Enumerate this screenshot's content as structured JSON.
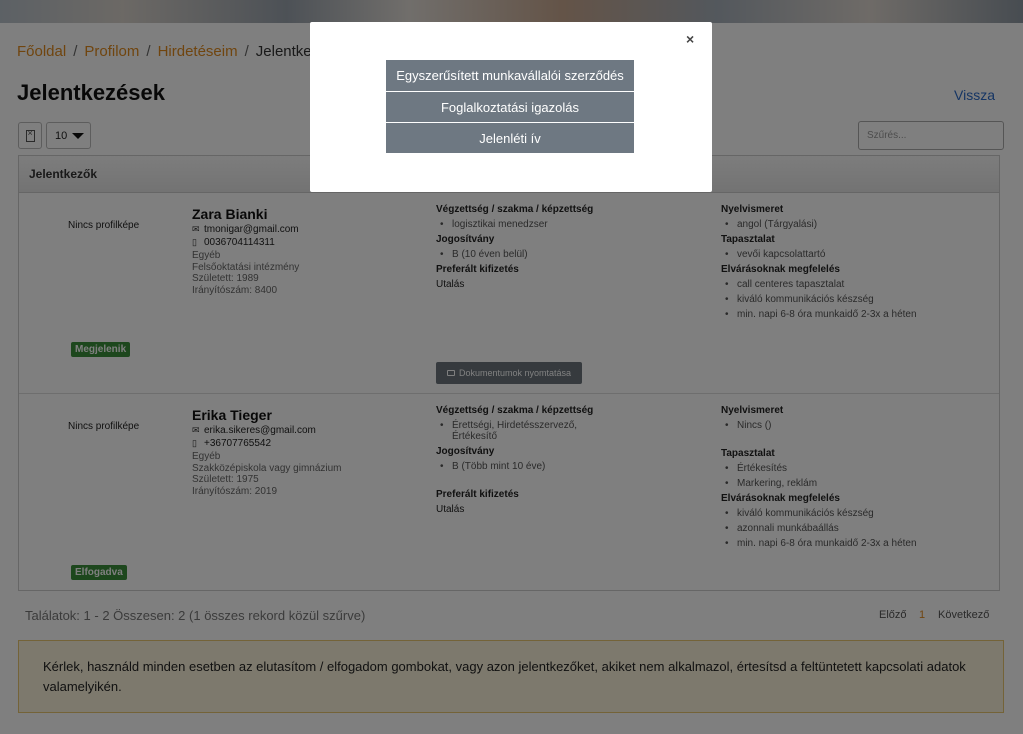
{
  "breadcrumb": {
    "home": "Főoldal",
    "profile": "Profilom",
    "ads": "Hirdetéseim",
    "current": "Jelentkez"
  },
  "page_title": "Jelentkezések",
  "back_label": "Vissza",
  "toolbar": {
    "excel_icon": "excel-export-icon",
    "per_page": "10",
    "filter_placeholder": "Szűrés..."
  },
  "panel_title": "Jelentkezők",
  "applicants": [
    {
      "photo_text": "Nincs profilképe",
      "name": "Zara Bianki",
      "email": "tmonigar@gmail.com",
      "phone": "0036704114311",
      "meta": [
        "Egyéb",
        "Felsőoktatási intézmény",
        "Született: 1989",
        "Irányítószám: 8400"
      ],
      "status": "Megjelenik",
      "col2": {
        "edu_title": "Végzettség / szakma / képzettség",
        "edu": [
          "logisztikai menedzser"
        ],
        "license_title": "Jogosítvány",
        "license": [
          "B (10 éven belül)"
        ],
        "pay_title": "Preferált kifizetés",
        "pay": "Utalás"
      },
      "col3": {
        "lang_title": "Nyelvismeret",
        "lang": [
          "angol (Tárgyalási)"
        ],
        "exp_title": "Tapasztalat",
        "exp": [
          "vevői kapcsolattartó"
        ],
        "req_title": "Elvárásoknak megfelelés",
        "req": [
          "call centeres tapasztalat",
          "kiváló kommunikációs készség",
          "min. napi 6-8 óra munkaidő 2-3x a héten"
        ]
      },
      "print_label": "Dokumentumok nyomtatása"
    },
    {
      "photo_text": "Nincs profilképe",
      "name": "Erika Tieger",
      "email": "erika.sikeres@gmail.com",
      "phone": "+36707765542",
      "meta": [
        "Egyéb",
        "Szakközépiskola vagy gimnázium",
        "Született: 1975",
        "Irányítószám: 2019"
      ],
      "status": "Elfogadva",
      "col2": {
        "edu_title": "Végzettség / szakma / képzettség",
        "edu": [
          "Érettségi, Hirdetésszervező, Értékesítő"
        ],
        "license_title": "Jogosítvány",
        "license": [
          "B (Több mint 10 éve)"
        ],
        "pay_title": "Preferált kifizetés",
        "pay": "Utalás"
      },
      "col3": {
        "lang_title": "Nyelvismeret",
        "lang": [
          "Nincs ()"
        ],
        "exp_title": "Tapasztalat",
        "exp": [
          "Értékesítés",
          "Markering, reklám"
        ],
        "req_title": "Elvárásoknak megfelelés",
        "req": [
          "kiváló kommunikációs készség",
          "azonnali munkábaállás",
          "min. napi 6-8 óra munkaidő 2-3x a héten"
        ]
      }
    }
  ],
  "footer": {
    "results": "Találatok: 1 - 2 Összesen: 2 (1 összes rekord közül szűrve)",
    "prev": "Előző",
    "page": "1",
    "next": "Következő"
  },
  "notice": "Kérlek, használd minden esetben az elutasítom / elfogadom gombokat, vagy azon jelentkezőket, akiket nem alkalmazol, értesítsd a feltüntetett kapcsolati adatok valamelyikén.",
  "modal": {
    "close": "×",
    "buttons": [
      "Egyszerűsített munkavállalói szerződés",
      "Foglalkoztatási igazolás",
      "Jelenléti ív"
    ]
  },
  "colors": {
    "link": "#e08a1e",
    "badge": "#3a8f3a",
    "button": "#6c757d",
    "alert_bg": "#fbf3da"
  }
}
